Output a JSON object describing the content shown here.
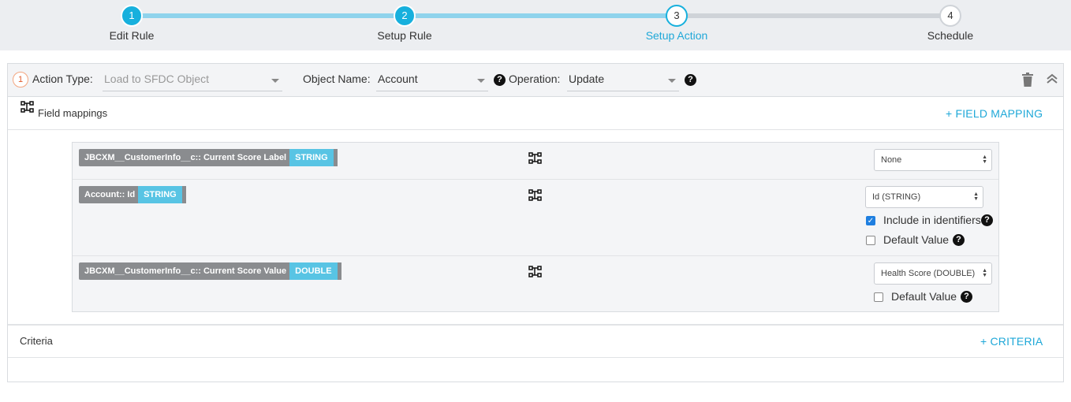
{
  "stepper": {
    "steps": [
      {
        "number": "1",
        "label": "Edit Rule",
        "state": "done"
      },
      {
        "number": "2",
        "label": "Setup Rule",
        "state": "done"
      },
      {
        "number": "3",
        "label": "Setup Action",
        "state": "current"
      },
      {
        "number": "4",
        "label": "Schedule",
        "state": "todo"
      }
    ]
  },
  "action": {
    "index": "1",
    "action_type_label": "Action Type:",
    "action_type_value": "Load to SFDC Object",
    "object_name_label": "Object Name:",
    "object_name_value": "Account",
    "operation_label": "Operation:",
    "operation_value": "Update",
    "help_glyph": "?"
  },
  "field_mappings": {
    "title": "Field mappings",
    "add_label": "+ FIELD MAPPING",
    "rows": [
      {
        "source": "JBCXM__CustomerInfo__c:: Current Score Label",
        "type": "STRING",
        "target": "None"
      },
      {
        "source": "Account:: Id",
        "type": "STRING",
        "target": "Id (STRING)",
        "include_identifiers_label": "Include in identifiers",
        "default_value_label": "Default Value"
      },
      {
        "source": "JBCXM__CustomerInfo__c:: Current Score Value",
        "type": "DOUBLE",
        "target": "Health Score (DOUBLE)",
        "default_value_label": "Default Value"
      }
    ]
  },
  "criteria": {
    "title": "Criteria",
    "add_label": "+ CRITERIA"
  },
  "colors": {
    "accent": "#17b0dd",
    "chip_type": "#58c4e4",
    "chip_bg": "#8a8c8f"
  }
}
